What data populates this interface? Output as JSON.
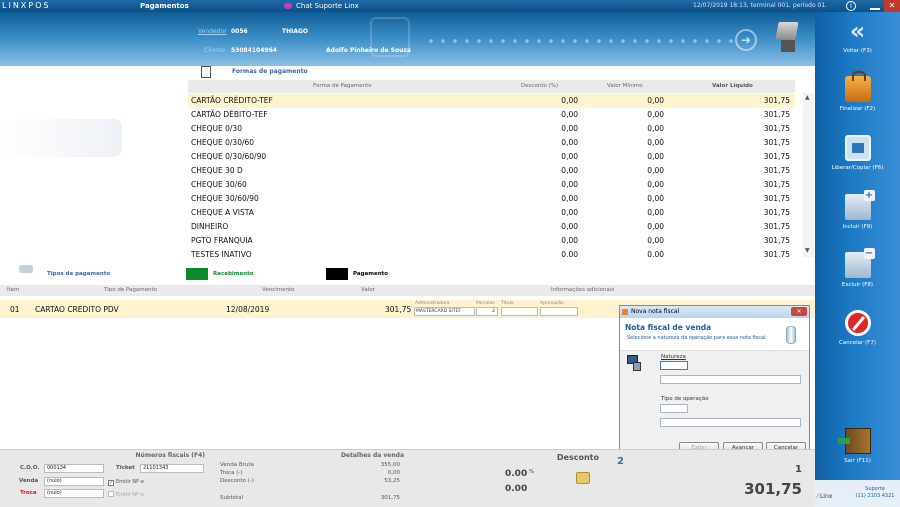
{
  "topbar": {
    "logo": "LINXPOS",
    "section": "Pagamentos",
    "chat": "Chat Suporte Linx",
    "status": "12/07/2019 18:13, terminal 001, período 01."
  },
  "header": {
    "vendedor_label": "Vendedor",
    "vendedor_code": "0056",
    "vendedor_name": "THIAGO",
    "cliente_label": "Cliente",
    "cliente_code": "53084104964",
    "cliente_name": "Adolfo Pinheiro de Souza"
  },
  "formas": {
    "title": "Formas de pagamento",
    "columns": [
      "Forma de Pagamento",
      "Desconto (%)",
      "Valor Mínimo",
      "Valor Líquido"
    ],
    "rows": [
      {
        "forma": "CARTÃO CRÉDITO-TEF",
        "desconto": "0,00",
        "minimo": "0,00",
        "liquido": "301,75"
      },
      {
        "forma": "CARTÃO DÉBITO-TEF",
        "desconto": "0,00",
        "minimo": "0,00",
        "liquido": "301,75"
      },
      {
        "forma": "CHEQUE 0/30",
        "desconto": "0,00",
        "minimo": "0,00",
        "liquido": "301,75"
      },
      {
        "forma": "CHEQUE 0/30/60",
        "desconto": "0,00",
        "minimo": "0,00",
        "liquido": "301,75"
      },
      {
        "forma": "CHEQUE 0/30/60/90",
        "desconto": "0,00",
        "minimo": "0,00",
        "liquido": "301,75"
      },
      {
        "forma": "CHEQUE 30 D",
        "desconto": "0,00",
        "minimo": "0,00",
        "liquido": "301,75"
      },
      {
        "forma": "CHEQUE 30/60",
        "desconto": "0,00",
        "minimo": "0,00",
        "liquido": "301,75"
      },
      {
        "forma": "CHEQUE 30/60/90",
        "desconto": "0,00",
        "minimo": "0,00",
        "liquido": "301,75"
      },
      {
        "forma": "CHEQUE A VISTA",
        "desconto": "0,00",
        "minimo": "0,00",
        "liquido": "301,75"
      },
      {
        "forma": "DINHEIRO",
        "desconto": "0,00",
        "minimo": "0,00",
        "liquido": "301,75"
      },
      {
        "forma": "PGTO FRANQUIA",
        "desconto": "0,00",
        "minimo": "0,00",
        "liquido": "301,75"
      },
      {
        "forma": "TESTES INATIVO",
        "desconto": "0,00",
        "minimo": "0,00",
        "liquido": "301,75"
      }
    ]
  },
  "legend": {
    "tipos": "Tipos de pagamento",
    "recebimento": "Recebimento",
    "pagamento": "Pagamento",
    "recebimento_color": "#0a8a2b",
    "pagamento_color": "#000000"
  },
  "tipos": {
    "columns": [
      "Item",
      "Tipo de Pagamento",
      "Vencimento",
      "Valor",
      "Informações adicionais"
    ],
    "row": {
      "item": "01",
      "tipo": "CARTAO CREDITO PDV",
      "vencimento": "12/08/2019",
      "valor": "301,75",
      "admin_label": "Administradora",
      "admin_value": "MASTERCARD SITEF",
      "parcelas_label": "Parcelas",
      "parcelas_value": "2",
      "titulo_label": "Título",
      "aprovacao_label": "Aprovação"
    }
  },
  "dialog": {
    "window_title": "Nova nota fiscal",
    "heading": "Nota fiscal de venda",
    "subheading": "Selecione a natureza da operação para essa nota fiscal.",
    "natureza_label": "Natureza",
    "tipo_label": "Tipo de operação",
    "btn_exibir": "Exibir",
    "btn_avancar": "Avançar",
    "btn_cancelar": "Cancelar"
  },
  "fiscais": {
    "title": "Números fiscais (F4)",
    "coo_label": "C.O.O.",
    "coo_value": "000134",
    "ticket_label": "Ticket",
    "ticket_value": "21101343",
    "venda_label": "Venda",
    "venda_value": "(nulo)",
    "troca_label": "Troca",
    "troca_value": "(nulo)",
    "emitir1": "Emitir NF-e",
    "emitir2": "Emitir NF-e"
  },
  "detalhes": {
    "title": "Detalhes da venda",
    "venda_bruta_label": "Venda Bruta",
    "venda_bruta": "355,00",
    "troca_label": "Troca (-)",
    "troca": "0,00",
    "desconto_label": "Desconto (-)",
    "desconto": "53,25",
    "subtotal_label": "Subtotal",
    "subtotal": "301,75"
  },
  "desconto": {
    "title": "Desconto",
    "pct": "0.00",
    "pct_unit": "%",
    "valor": "0.00"
  },
  "totais": {
    "marker": "2",
    "qty": "1",
    "total": "301,75"
  },
  "sidebar": {
    "voltar": "Voltar (F3)",
    "finalizar": "Finalizar (F2)",
    "liberar": "Liberar/Copiar (F6)",
    "incluir": "Incluir (F9)",
    "excluir": "Excluir (F8)",
    "cancelar": "Cancelar (F7)",
    "sair": "Sair (F11)",
    "brand": "Linx",
    "suporte": "Suporte",
    "phone": "(11) 2103 4321"
  }
}
